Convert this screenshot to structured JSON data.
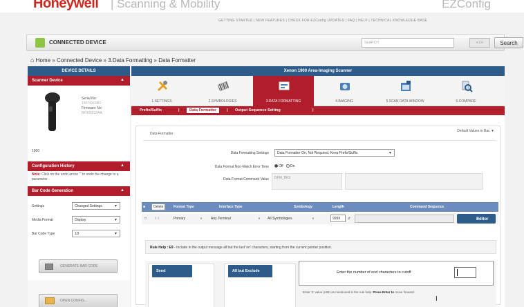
{
  "brand": {
    "logo": "Honeywell",
    "tagline": "| Scanning & Mobility",
    "product": "EZConfig"
  },
  "top_links": "GETTING STARTED | NEW FEATURES | CHECK FOR EZConfig UPDATES | FAQ | HELP | TECHNICAL KNOWLEDGE BASE",
  "connected_bar": {
    "title": "CONNECTED DEVICE",
    "search_placeholder": "SEARCH",
    "pager": "« | »",
    "search_button": "Search"
  },
  "breadcrumb": {
    "home": "Home",
    "sep": "»",
    "items": [
      "Connected Device",
      "3.Data Formatting",
      "Data Formatter"
    ]
  },
  "sidebar": {
    "header": "DEVICE DETAILS",
    "scanner_section": "Scanner Device",
    "serial_label": "Serial No:",
    "serial_value": "15074X0381",
    "firmware_label": "Firmware No:",
    "firmware_value": "BF000233AA",
    "model": "1900",
    "config_history": "Configuration History",
    "history_note_b": "Note:",
    "history_note": " Click on the undo arrow \"\" to undo the change to a parameter.",
    "barcode_section": "Bar Code Generation",
    "settings_label": "Settings",
    "settings_value": "Changed Settings",
    "media_label": "Media Format",
    "media_value": "Display",
    "bartype_label": "Bar Code Type",
    "bartype_value": "1D",
    "generate_button": "GENERATE BAR CODE",
    "open_button": "OPEN CONFIG..."
  },
  "main": {
    "header": "Xenon 1900 Area-Imaging Scanner",
    "tabs": [
      {
        "label": "1.SETTINGS",
        "icon": "tools-icon"
      },
      {
        "label": "2.SYMBOLOGIES",
        "icon": "barcode-icon"
      },
      {
        "label": "3.DATA FORMATTING",
        "icon": "data-formatting-icon"
      },
      {
        "label": "4.IMAGING",
        "icon": "camera-icon"
      },
      {
        "label": "5.SCAN DATA WINDOW",
        "icon": "scan-window-icon"
      },
      {
        "label": "6.COMPARE",
        "icon": "compare-icon"
      }
    ],
    "subtabs": [
      "Prefix/Suffix",
      "Data Formatter",
      "Output Sequence Setting"
    ],
    "sub_sep": "|",
    "panel_title": "Data Formatter",
    "default_values": "Default Values in Bac",
    "fmt_settings_label": "Data Formatting Settings",
    "fmt_settings_value": "Data Formatter On, Not Required, Keep Prefix/Suffix",
    "non_match_label": "Data Format Non-Match Error Tone",
    "radio_off": "Off",
    "radio_on": "On",
    "cmd_value_label": "Data Format Command Value",
    "cmd_value": "DFM_BK3",
    "table_headers": [
      "Delete",
      "Format Type",
      "Interface Type",
      "Symbology",
      "Length",
      "Command Sequence"
    ],
    "row": {
      "format_type": "Primary",
      "interface": "Any Terminal",
      "symbology": "All Symbologies",
      "length": "9999",
      "editor": "Editor"
    },
    "help_b": "Rule Help : E9",
    "help_text": " - Include in the output message all but the last 'nn' characters, starting from the current pointer position.",
    "send_button": "Send",
    "allbut_button": "All but Exclude",
    "cut_prompt": "Enter the number of end characters to cutoff",
    "note_text": "Enter 'n' value (n99) as mentioned in the rule help.",
    "note_b": "Press Enter to",
    "note_tail": "move forward."
  }
}
